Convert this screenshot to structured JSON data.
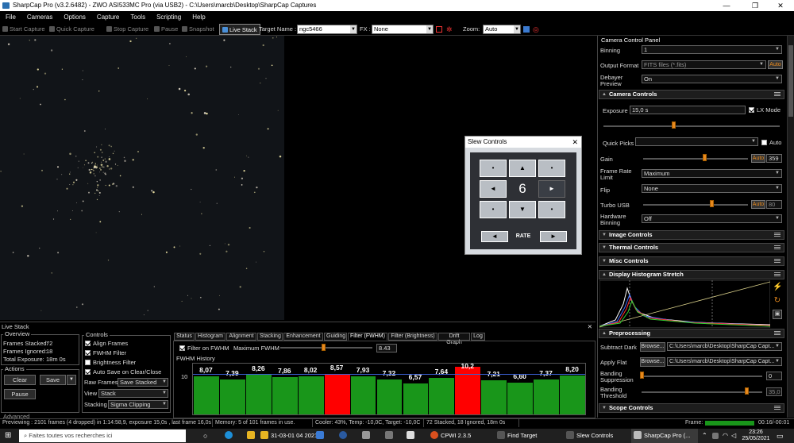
{
  "window": {
    "title": "SharpCap Pro (v3.2.6482) - ZWO ASI533MC Pro (via USB2) - C:\\Users\\marcb\\Desktop\\SharpCap Captures",
    "minimize": "—",
    "maximize": "❐",
    "close": "✕"
  },
  "menu": [
    "File",
    "Cameras",
    "Options",
    "Capture",
    "Tools",
    "Scripting",
    "Help"
  ],
  "toolbar": {
    "start_capture": "Start Capture",
    "quick_capture": "Quick Capture",
    "stop_capture": "Stop Capture",
    "pause": "Pause",
    "snapshot": "Snapshot",
    "live_stack": "Live Stack",
    "target_name_label": "Target Name :",
    "target_name_value": "ngc5466",
    "fx_label": "FX :",
    "fx_value": "None",
    "zoom_label": "Zoom:",
    "zoom_value": "Auto"
  },
  "live_stack": {
    "title": "Live Stack",
    "close": "✕",
    "overview": {
      "title": "Overview",
      "frames_stacked": "Frames Stacked:",
      "frames_stacked_val": "72",
      "frames_ignored": "Frames Ignored:",
      "frames_ignored_val": "18",
      "total_exposure": "Total Exposure:",
      "total_exposure_val": "18m 0s"
    },
    "actions": {
      "title": "Actions",
      "clear": "Clear",
      "save": "Save",
      "pause": "Pause",
      "advanced": "Advanced"
    },
    "controls": {
      "title": "Controls",
      "align_frames": "Align Frames",
      "fwhm_filter": "FWHM Filter",
      "brightness_filter": "Brightness Filter",
      "auto_save": "Auto Save on Clear/Close",
      "raw_frames_label": "Raw Frames",
      "raw_frames_value": "Save Stacked",
      "view_label": "View",
      "view_value": "Stack",
      "stacking_label": "Stacking",
      "stacking_value": "Sigma Clipping"
    },
    "tabs": [
      "Status",
      "Histogram",
      "Alignment",
      "Stacking",
      "Enhancement",
      "Guiding",
      "Filter (FWHM)",
      "Filter (Brightness)",
      "Drift Graph",
      "Log"
    ],
    "fwhm": {
      "filter_label": "Filter on FWHM",
      "max_label": "Maximum FWHM",
      "max_value": "8.43",
      "history_label": "FWHM History",
      "axis_label": "10"
    }
  },
  "chart_data": {
    "type": "bar",
    "title": "FWHM History",
    "values": [
      8.07,
      7.39,
      8.26,
      7.86,
      8.02,
      8.57,
      7.93,
      7.32,
      6.57,
      7.64,
      10.2,
      7.21,
      6.6,
      7.37,
      8.2
    ],
    "labels": [
      "8,07",
      "7,39",
      "8,26",
      "7,86",
      "8,02",
      "8,57",
      "7,93",
      "7,32",
      "6,57",
      "7,64",
      "10,2",
      "7,21",
      "6,60",
      "7,37",
      "8,20"
    ],
    "rejected": [
      false,
      false,
      false,
      false,
      false,
      true,
      false,
      false,
      false,
      false,
      true,
      false,
      false,
      false,
      false
    ],
    "ylim": [
      0,
      10
    ],
    "threshold": 8.43,
    "colors": {
      "accepted": "#19961a",
      "rejected": "#ff0000"
    }
  },
  "slew": {
    "title": "Slew Controls",
    "close": "✕",
    "rate": "6",
    "rate_label": "RATE",
    "up": "▲",
    "down": "▼",
    "left": "◄",
    "right": "►",
    "diag": "•"
  },
  "panel": {
    "title": "Camera Control Panel",
    "binning_label": "Binning",
    "binning_value": "1",
    "output_format_label": "Output Format",
    "output_format_value": "FITS files (*.fits)",
    "auto": "Auto",
    "debayer_label": "Debayer Preview",
    "debayer_value": "On",
    "camera_controls": "Camera Controls",
    "exposure_label": "Exposure",
    "exposure_value": "15,0 s",
    "lx_mode": "LX Mode",
    "quick_picks_label": "Quick Picks",
    "gain_label": "Gain",
    "gain_value": "359",
    "frame_rate_label": "Frame Rate Limit",
    "frame_rate_value": "Maximum",
    "flip_label": "Flip",
    "flip_value": "None",
    "turbo_usb_label": "Turbo USB",
    "turbo_usb_value": "80",
    "hw_binning_label": "Hardware Binning",
    "hw_binning_value": "Off",
    "image_controls": "Image Controls",
    "thermal_controls": "Thermal Controls",
    "misc_controls": "Misc Controls",
    "display_stretch": "Display Histogram Stretch",
    "preprocessing": "Preprocessing",
    "subtract_dark_label": "Subtract Dark",
    "browse": "Browse...",
    "subtract_dark_path": "C:\\Users\\marcb\\Desktop\\SharpCap Capt...",
    "apply_flat_label": "Apply Flat",
    "apply_flat_path": "C:\\Users\\marcb\\Desktop\\SharpCap Capt...",
    "banding_supp_label": "Banding Suppression",
    "banding_supp_value": "0",
    "banding_thr_label": "Banding Threshold",
    "banding_thr_value": "35,0",
    "scope_controls": "Scope Controls"
  },
  "status": {
    "previewing": "Previewing : 2101 frames (4 dropped) in 1:14:58,9, exposure 15,0s , last frame 16,0s",
    "memory": "Memory: 5 of 101 frames in use.",
    "cooler": "Cooler: 43%, Temp: -10,0C, Target: -10,0C",
    "stacked": "72 Stacked, 18 Ignored, 18m 0s",
    "frame_label": "Frame:",
    "frame_time": "00:16/-00:01"
  },
  "taskbar": {
    "search": "Faites toutes vos recherches ici",
    "date_item": "31-03-01 04 2021",
    "cpwi": "CPWI 2.3.5",
    "find_target": "Find Target",
    "slew_controls": "Slew Controls",
    "sharpcap": "SharpCap Pro (...",
    "time": "23:26",
    "date": "25/05/2021"
  }
}
